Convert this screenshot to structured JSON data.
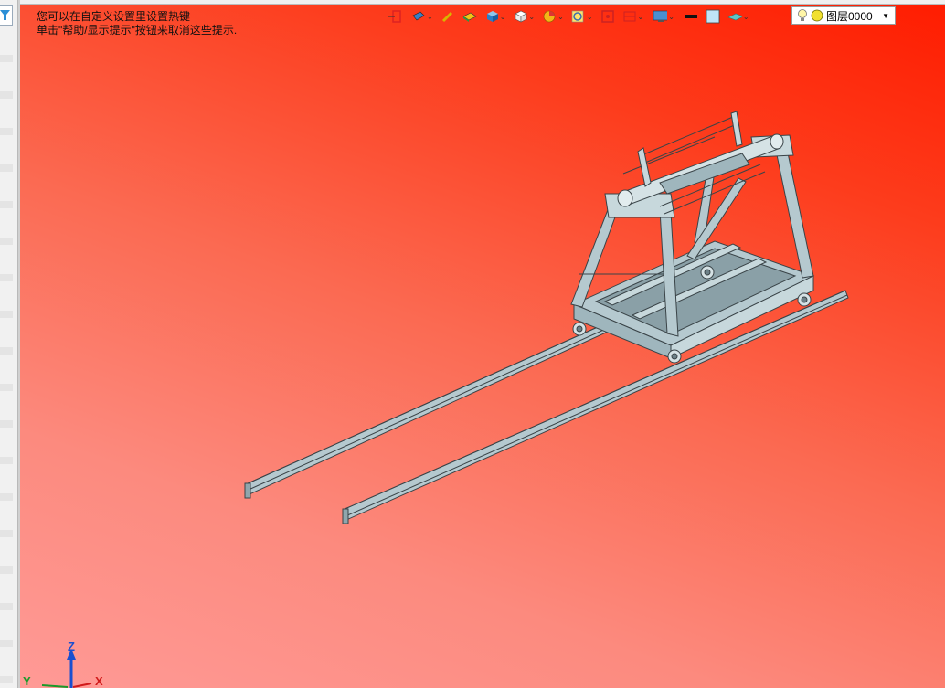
{
  "hint": {
    "line1": "您可以在自定义设置里设置热键",
    "line2": "单击\"帮助/显示提示\"按钮来取消这些提示."
  },
  "toolbar": {
    "icons": [
      "exit-icon",
      "render-mode-icon",
      "pencil-icon",
      "face-color-icon",
      "solid-cube-icon",
      "view-cube-icon",
      "pie-section-icon",
      "zoom-icon",
      "target-icon",
      "frame-icon",
      "display-icon",
      "line-width-icon",
      "color-swatch-icon",
      "surface-icon"
    ]
  },
  "layer_box": {
    "label": "图层0000",
    "dropdown": "▼"
  },
  "triad": {
    "z": "Z",
    "y": "Y",
    "x": "X"
  },
  "colors": {
    "bg_top": "#ff1c00",
    "bg_bottom": "#ff9a96",
    "model": "#b5c9cf",
    "edge": "#3a4448"
  }
}
